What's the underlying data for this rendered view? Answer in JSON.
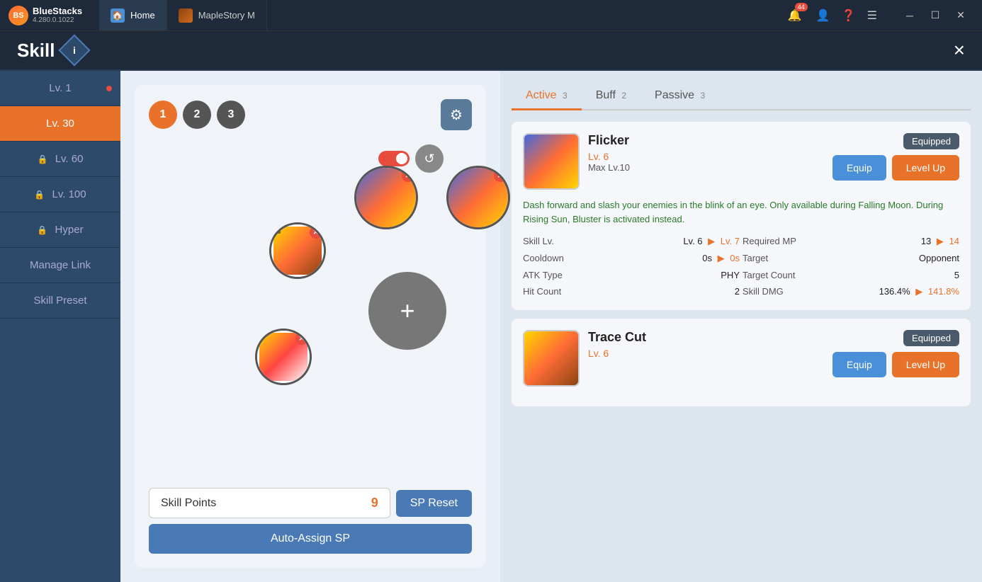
{
  "topbar": {
    "logo_name": "BlueStacks",
    "logo_version": "4.280.0.1022",
    "tab_home": "Home",
    "tab_game": "MapleStory M",
    "notif_count": "44"
  },
  "appbar": {
    "title": "Skill",
    "close": "×"
  },
  "sidebar": {
    "items": [
      {
        "label": "Lv. 1",
        "locked": false,
        "dot": true
      },
      {
        "label": "Lv. 30",
        "locked": false,
        "active": true,
        "dot": false
      },
      {
        "label": "Lv. 60",
        "locked": true,
        "dot": false
      },
      {
        "label": "Lv. 100",
        "locked": true,
        "dot": false
      },
      {
        "label": "Hyper",
        "locked": true,
        "dot": false
      },
      {
        "label": "Manage Link",
        "locked": false,
        "dot": false
      },
      {
        "label": "Skill Preset",
        "locked": false,
        "dot": false
      }
    ]
  },
  "skill_panel": {
    "orbs": [
      "1",
      "2",
      "3"
    ],
    "add_label": "+",
    "sp_label": "Skill Points",
    "sp_value": "9",
    "sp_reset": "SP Reset",
    "auto_assign": "Auto-Assign SP"
  },
  "right_panel": {
    "tabs": [
      {
        "label": "Active",
        "count": "3",
        "active": true
      },
      {
        "label": "Buff",
        "count": "2",
        "active": false
      },
      {
        "label": "Passive",
        "count": "3",
        "active": false
      }
    ],
    "skills": [
      {
        "name": "Flicker",
        "level": "Lv. 6",
        "max_lv": "Max Lv.10",
        "equipped": "Equipped",
        "equip_btn": "Equip",
        "levelup_btn": "Level Up",
        "desc": "Dash forward and slash your enemies in the blink of an eye. Only available during Falling Moon. During Rising Sun, Bluster is activated instead.",
        "stats": [
          {
            "label": "Skill Lv.",
            "val": "Lv. 6",
            "next": "Lv. 7"
          },
          {
            "label": "Required MP",
            "val": "13",
            "next": "14"
          },
          {
            "label": "Cooldown",
            "val": "0s",
            "next": "0s"
          },
          {
            "label": "Target",
            "val": "Opponent",
            "next": ""
          },
          {
            "label": "ATK Type",
            "val": "PHY",
            "next": ""
          },
          {
            "label": "Target Count",
            "val": "5",
            "next": ""
          },
          {
            "label": "Hit Count",
            "val": "2",
            "next": ""
          },
          {
            "label": "Skill DMG",
            "val": "136.4%",
            "next": "141.8%"
          }
        ]
      },
      {
        "name": "Trace Cut",
        "level": "Lv. 6",
        "max_lv": "",
        "equipped": "Equipped",
        "equip_btn": "Equip",
        "levelup_btn": "Level Up",
        "desc": "",
        "stats": []
      }
    ]
  }
}
